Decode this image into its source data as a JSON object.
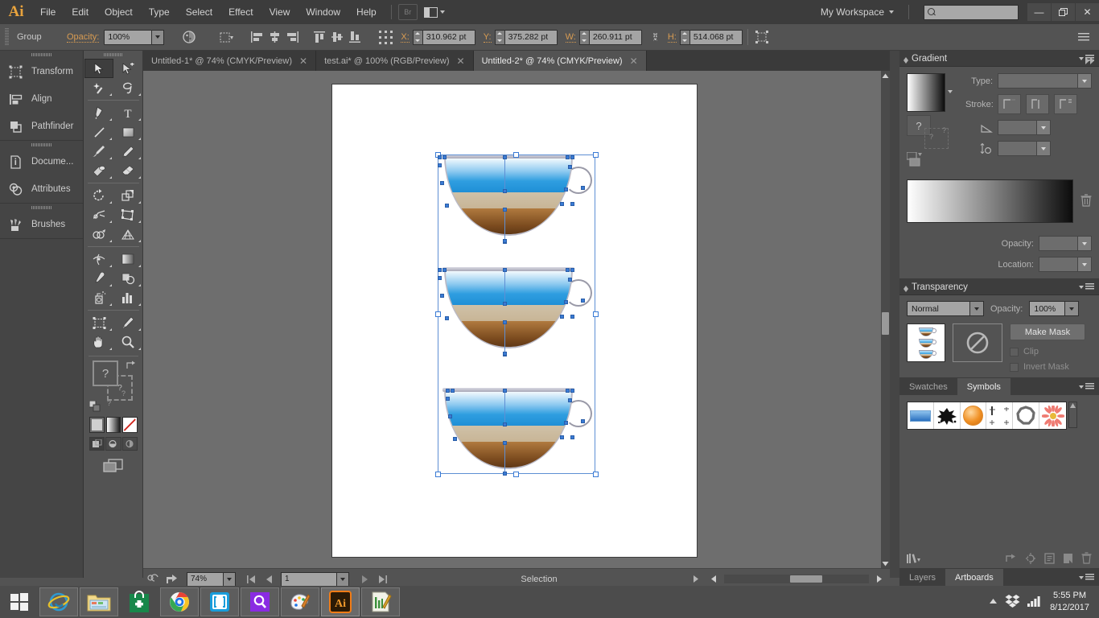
{
  "app": {
    "name": "Adobe Illustrator",
    "logo_text": "Ai"
  },
  "menubar": {
    "items": [
      "File",
      "Edit",
      "Object",
      "Type",
      "Select",
      "Effect",
      "View",
      "Window",
      "Help"
    ],
    "bridge_label": "Br",
    "arrange_label": "",
    "workspace": "My Workspace",
    "search_placeholder": "",
    "window_buttons": {
      "minimize": "—",
      "restore": "❐",
      "close": "✕"
    }
  },
  "controlbar": {
    "selection_type": "Group",
    "opacity_label": "Opacity:",
    "opacity_value": "100%",
    "x_label": "X:",
    "x_value": "310.962 pt",
    "y_label": "Y:",
    "y_value": "375.282 pt",
    "w_label": "W:",
    "w_value": "260.911 pt",
    "h_label": "H:",
    "h_value": "514.068 pt"
  },
  "tabs": [
    {
      "label": "Untitled-1* @ 74% (CMYK/Preview)",
      "close": "✕",
      "active": false
    },
    {
      "label": "test.ai* @ 100% (RGB/Preview)",
      "close": "✕",
      "active": false
    },
    {
      "label": "Untitled-2* @ 74% (CMYK/Preview)",
      "close": "✕",
      "active": true
    }
  ],
  "left_dock": {
    "groups": [
      {
        "items": [
          {
            "label": "Transform",
            "icon": "transform-icon"
          },
          {
            "label": "Align",
            "icon": "align-icon"
          },
          {
            "label": "Pathfinder",
            "icon": "pathfinder-icon"
          }
        ]
      },
      {
        "items": [
          {
            "label": "Docume...",
            "icon": "document-info-icon"
          },
          {
            "label": "Attributes",
            "icon": "attributes-icon"
          }
        ]
      },
      {
        "items": [
          {
            "label": "Brushes",
            "icon": "brushes-icon"
          }
        ]
      }
    ]
  },
  "toolbar": {
    "active_tool": "selection-tool",
    "tools": [
      "selection-tool",
      "direct-selection-tool",
      "magic-wand-tool",
      "lasso-tool",
      "pen-tool",
      "type-tool",
      "line-segment-tool",
      "rectangle-tool",
      "paintbrush-tool",
      "pencil-tool",
      "blob-brush-tool",
      "eraser-tool",
      "rotate-tool",
      "scale-tool",
      "width-tool",
      "free-transform-tool",
      "shape-builder-tool",
      "perspective-grid-tool",
      "mesh-tool",
      "gradient-tool",
      "eyedropper-tool",
      "blend-tool",
      "symbol-sprayer-tool",
      "column-graph-tool",
      "artboard-tool",
      "slice-tool",
      "hand-tool",
      "zoom-tool"
    ],
    "fill_label": "?",
    "stroke_label": "?",
    "color_modes": [
      "color-swatch",
      "gradient-swatch",
      "none-swatch"
    ],
    "draw_modes": [
      "draw-normal",
      "draw-behind",
      "draw-inside"
    ],
    "screen_mode": "change-screen-mode"
  },
  "canvas": {
    "artwork_name": "three-coffee-cups",
    "cups": [
      {
        "name": "coffee-cup-top"
      },
      {
        "name": "coffee-cup-middle"
      },
      {
        "name": "coffee-cup-bottom"
      }
    ],
    "colors": {
      "liquid_top": "#8dc9f0",
      "liquid_blue": "#2f9ee0",
      "cream_band": "#cfc1a8",
      "coffee_brown": "#7a4a1e",
      "rim_gray": "#b9b9c6",
      "selection_blue": "#3a7bd5"
    }
  },
  "statusbar": {
    "zoom_value": "74%",
    "page_value": "1",
    "status_text": "Selection"
  },
  "panels": {
    "gradient": {
      "title": "Gradient",
      "type_label": "Type:",
      "type_value": "",
      "stroke_label": "Stroke:",
      "angle_value": "",
      "aspect_value": "",
      "opacity_label": "Opacity:",
      "opacity_value": "",
      "location_label": "Location:",
      "location_value": "",
      "delete_icon": "trash-icon"
    },
    "transparency": {
      "title": "Transparency",
      "blend_mode": "Normal",
      "opacity_label": "Opacity:",
      "opacity_value": "100%",
      "make_mask_label": "Make Mask",
      "clip_label": "Clip",
      "invert_mask_label": "Invert Mask"
    },
    "symbols": {
      "tabs": [
        {
          "label": "Swatches",
          "active": false
        },
        {
          "label": "Symbols",
          "active": true
        }
      ],
      "items": [
        {
          "name": "symbol-blue-gradient-rectangle"
        },
        {
          "name": "symbol-black-splat"
        },
        {
          "name": "symbol-orange-sphere"
        },
        {
          "name": "symbol-crop-marks"
        },
        {
          "name": "symbol-gray-ring"
        },
        {
          "name": "symbol-red-flower"
        }
      ],
      "footer_icons": [
        "symbol-libraries-icon",
        "place-symbol-instance-icon",
        "break-link-icon",
        "symbol-options-icon",
        "new-symbol-icon",
        "delete-symbol-icon"
      ]
    },
    "layers": {
      "tabs": [
        {
          "label": "Layers",
          "active": false
        },
        {
          "label": "Artboards",
          "active": true
        }
      ]
    }
  },
  "taskbar": {
    "start": "windows-start-icon",
    "apps": [
      {
        "name": "internet-explorer-icon",
        "state": "open"
      },
      {
        "name": "file-explorer-icon",
        "state": "open"
      },
      {
        "name": "microsoft-store-icon",
        "state": "pinned"
      },
      {
        "name": "google-chrome-icon",
        "state": "open"
      },
      {
        "name": "brackets-icon",
        "state": "open"
      },
      {
        "name": "search-cortana-icon",
        "state": "open"
      },
      {
        "name": "paint-icon",
        "state": "open"
      },
      {
        "name": "adobe-illustrator-icon",
        "state": "active"
      },
      {
        "name": "notepad-plus-plus-icon",
        "state": "open"
      }
    ],
    "tray": [
      "show-hidden-icons-arrow",
      "dropbox-icon",
      "network-signal-icon"
    ],
    "clock_time": "5:55 PM",
    "clock_date": "8/12/2017"
  }
}
